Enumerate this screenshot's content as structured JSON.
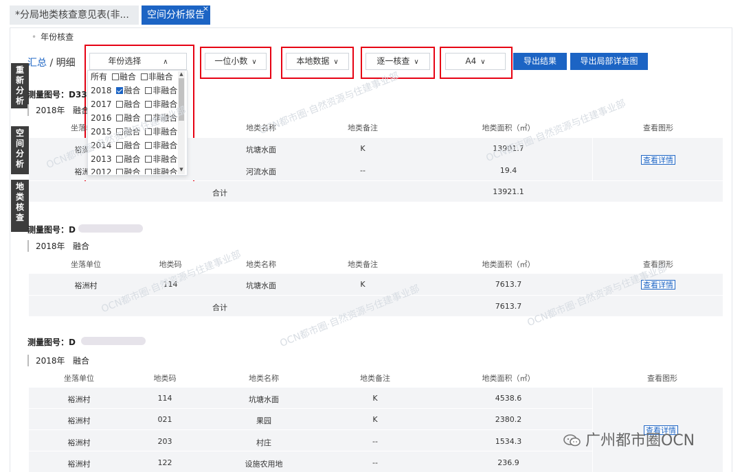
{
  "tabs": [
    {
      "label": "*分局地类核查意见表(非..."
    },
    {
      "label": "空间分析报告",
      "close": "×"
    }
  ],
  "section_label": "年份核查",
  "view_toggle": {
    "summary": "汇总",
    "separator": " / ",
    "detail": "明细"
  },
  "side_tabs": [
    "重新分析",
    "空间分析",
    "地类核查"
  ],
  "controls": {
    "year_select": {
      "label": "年份选择",
      "chevron": "∧"
    },
    "decimal": {
      "label": "一位小数",
      "chevron": "∨"
    },
    "data_source": {
      "label": "本地数据",
      "chevron": "∨"
    },
    "check_mode": {
      "label": "逐一核查",
      "chevron": "∨"
    },
    "paper": {
      "label": "A4",
      "chevron": "∨"
    },
    "export_result": "导出结果",
    "export_local": "导出局部详查图"
  },
  "year_dropdown": {
    "all": {
      "label": "所有",
      "opt1": "融合",
      "opt2": "非融合"
    },
    "years": [
      {
        "year": "2018",
        "fused": true,
        "opt1": "融合",
        "opt2": "非融合"
      },
      {
        "year": "2017",
        "fused": false,
        "opt1": "融合",
        "opt2": "非融合"
      },
      {
        "year": "2016",
        "fused": false,
        "opt1": "融合",
        "opt2": "非融合"
      },
      {
        "year": "2015",
        "fused": false,
        "opt1": "融合",
        "opt2": "非融合"
      },
      {
        "year": "2014",
        "fused": false,
        "opt1": "融合",
        "opt2": "非融合"
      },
      {
        "year": "2013",
        "fused": false,
        "opt1": "融合",
        "opt2": "非融合"
      },
      {
        "year": "2012",
        "fused": false,
        "opt1": "融合",
        "opt2": "非融合"
      }
    ]
  },
  "headers": {
    "location": "坐落单位",
    "code": "地类码",
    "name": "地类名称",
    "note": "地类备注",
    "area": "地类面积（㎡）",
    "view": "查看图形"
  },
  "sections": [
    {
      "title": "测量图号：D335",
      "year": "2018年",
      "mode": "融合",
      "rows": [
        {
          "location": "裕洲村",
          "code": "",
          "name": "坑塘水面",
          "note": "K",
          "area": "13901.7"
        },
        {
          "location": "裕洲村",
          "code": "",
          "name": "河流水面",
          "note": "--",
          "area": "19.4"
        }
      ],
      "total_label": "合计",
      "total": "13921.1",
      "detail_btn": "查看详情"
    },
    {
      "title": "测量图号：D",
      "year": "2018年",
      "mode": "融合",
      "rows": [
        {
          "location": "裕洲村",
          "code": "114",
          "name": "坑塘水面",
          "note": "K",
          "area": "7613.7"
        }
      ],
      "total_label": "合计",
      "total": "7613.7",
      "detail_btn": "查看详情"
    },
    {
      "title": "测量图号：D",
      "year": "2018年",
      "mode": "融合",
      "rows": [
        {
          "location": "裕洲村",
          "code": "114",
          "name": "坑塘水面",
          "note": "K",
          "area": "4538.6"
        },
        {
          "location": "裕洲村",
          "code": "021",
          "name": "果园",
          "note": "K",
          "area": "2380.2"
        },
        {
          "location": "裕洲村",
          "code": "203",
          "name": "村庄",
          "note": "--",
          "area": "1534.3"
        },
        {
          "location": "裕洲村",
          "code": "122",
          "name": "设施农用地",
          "note": "--",
          "area": "236.9"
        }
      ],
      "detail_btn": "查看详情"
    }
  ],
  "watermark": "OCN都市圈·自然资源与住建事业部",
  "brand": "广州都市圈OCN",
  "colors": {
    "accent": "#1c64c4",
    "highlight": "#e60012",
    "dark_tab": "#3d3d3d"
  }
}
